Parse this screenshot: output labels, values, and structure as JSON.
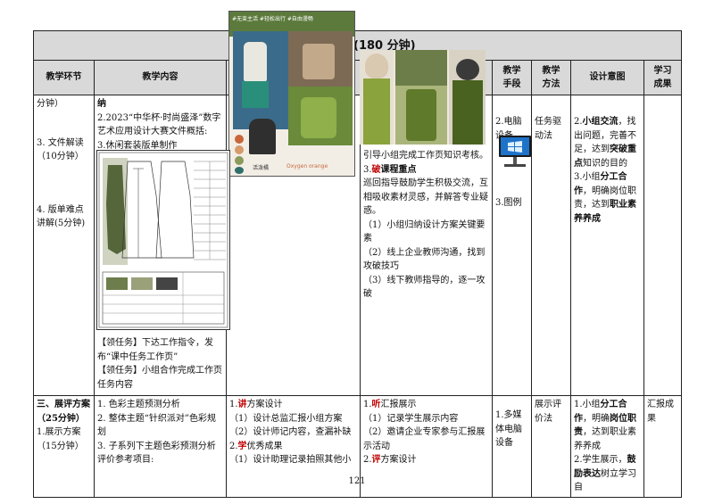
{
  "banner": {
    "duration": "(180 分钟)"
  },
  "headers": {
    "phase": "教学环节",
    "content": "教学内容",
    "media_1": "教学",
    "media_2": "手段",
    "method_1": "教学",
    "method_2": "方法",
    "intent": "设计意图",
    "outcome_1": "学习",
    "outcome_2": "成果"
  },
  "row1": {
    "phase": [
      "分钟）",
      "3. 文件解读",
      "（10分钟）",
      "4. 版单难点",
      "讲解(5分钟)"
    ],
    "content_top": [
      "纳",
      "2.2023“中华杯·时尚盛泽”数字艺术应用设计大赛文件概括:",
      "3.休闲套装版单制作"
    ],
    "content_bottom": [
      "【领任务】下达工作指令，发布“课中任务工作页”",
      "【领任务】小组合作完成工作页任务内容"
    ],
    "activity": {
      "line1": "引导小组完成工作页知识考核。",
      "p3_num": "3.",
      "p3_red": "破",
      "p3_rest": "课程重点",
      "p3_body": "巡回指导鼓励学生积极交流，互相吸收素材灵感，并解答专业疑惑。",
      "s1": "（1）小组归纳设计方案关键要素",
      "s2": "（2）线上企业教师沟通，找到攻破技巧",
      "s3": "（3）线下教师指导的，逐一攻破"
    },
    "media": [
      "2.电脑设备",
      "3.图例"
    ],
    "method": "任务驱动法",
    "intent": {
      "i2_num": "2.",
      "i2_b": "小组交流",
      "i2_a": "，找出问题，完善不足，达到",
      "i2_b2": "突破重点",
      "i2_c": "知识的目的",
      "i3_a": "3.小组",
      "i3_b": "分工合作",
      "i3_c": "，明确岗位职责，达到",
      "i3_d": "职业素养养成"
    }
  },
  "row2": {
    "phase_title": "三、展评方案",
    "phase_time": "（25分钟）",
    "phase_sub": [
      "1.展示方案",
      "（15分钟）"
    ],
    "content": [
      "1. 色彩主题预测分析",
      "2. 整体主题“针织派对”色彩规划",
      "3. 子系列下主题色彩预测分析评价参考项目:"
    ],
    "teacher": {
      "t1_num": "1.",
      "t1_red": "讲",
      "t1_rest": "方案设计",
      "t1a": "（1）设计总监汇报小组方案",
      "t1b": "（2）设计师记内容，查漏补缺",
      "t2_num": "2.",
      "t2_red": "学",
      "t2_rest": "优秀成果",
      "t2a": "（1）设计助理记录拍照其他小"
    },
    "student": {
      "s1_num": "1.",
      "s1_red": "听",
      "s1_rest": "汇报展示",
      "s1a": "（1）记录学生展示内容",
      "s1b": "（2）邀请企业专家参与汇报展示活动",
      "s2_num": "2.",
      "s2_red": "评",
      "s2_rest": "方案设计"
    },
    "media": "1.多媒体电脑设备",
    "method": "展示评价法",
    "intent": {
      "a": "1.小组",
      "b": "分工合作",
      "c": "，明确",
      "d": "岗位职责",
      "e": "，达到职业素养养成",
      "f": "2.学生展示，",
      "g": "鼓励表达",
      "h": "树立学习自"
    },
    "outcome": "汇报成果"
  },
  "moodboard": {
    "tags": "#无束主活 #轻松出行 #自由漫畅",
    "label_a": "活泼橘",
    "label_b": "Oxygen orange",
    "colors": [
      "#c8663a",
      "#d79a6a",
      "#8c9a5a",
      "#5a6f3a",
      "#2f6f6a"
    ]
  },
  "page_number": "121"
}
